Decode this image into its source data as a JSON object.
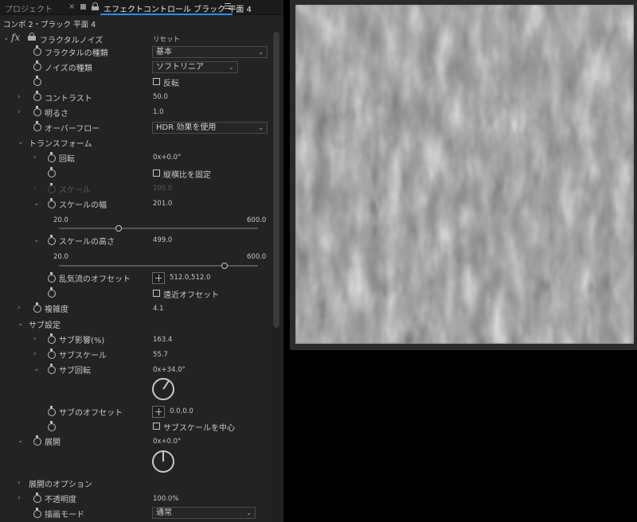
{
  "tabs": {
    "project": "プロジェクト",
    "close": "×",
    "effect_controls": "エフェクトコントロール ブラック 平面 4"
  },
  "comp_path": "コンポ 2・ブラック 平面 4",
  "effect": {
    "name": "フラクタルノイズ",
    "reset": "リセット"
  },
  "properties": {
    "fractal_type": {
      "label": "フラクタルの種類",
      "value": "基本"
    },
    "noise_type": {
      "label": "ノイズの種類",
      "value": "ソフトリニア"
    },
    "invert": {
      "label": "反転",
      "checked": false
    },
    "contrast": {
      "label": "コントラスト",
      "value": "50.0"
    },
    "brightness": {
      "label": "明るさ",
      "value": "1.0"
    },
    "overflow": {
      "label": "オーバーフロー",
      "value": "HDR 効果を使用"
    },
    "transform": {
      "label": "トランスフォーム",
      "rotation": {
        "label": "回転",
        "value": "0x+0.0°"
      },
      "uniform_scaling": {
        "label": "縦横比を固定",
        "checked": false
      },
      "scale": {
        "label": "スケール",
        "value": "100.0"
      },
      "scale_width": {
        "label": "スケールの幅",
        "value": "201.0",
        "min": "20.0",
        "max": "600.0",
        "fraction": 0.3
      },
      "scale_height": {
        "label": "スケールの高さ",
        "value": "499.0",
        "min": "20.0",
        "max": "600.0",
        "fraction": 0.83
      },
      "offset_turbulence": {
        "label": "乱気流のオフセット",
        "value": "512.0,512.0"
      },
      "perspective_offset": {
        "label": "遠近オフセット",
        "checked": false
      }
    },
    "complexity": {
      "label": "複雑度",
      "value": "4.1"
    },
    "sub_settings": {
      "label": "サブ設定",
      "sub_influence": {
        "label": "サブ影響(%)",
        "value": "163.4"
      },
      "sub_scaling": {
        "label": "サブスケール",
        "value": "55.7"
      },
      "sub_rotation": {
        "label": "サブ回転",
        "value": "0x+34.0°",
        "angle": 34
      },
      "sub_offset": {
        "label": "サブのオフセット",
        "value": "0.0,0.0"
      },
      "center_subscale": {
        "label": "サブスケールを中心",
        "checked": false
      }
    },
    "evolution": {
      "label": "展開",
      "value": "0x+0.0°",
      "angle": 0
    },
    "evolution_options": {
      "label": "展開のオプション"
    },
    "opacity": {
      "label": "不透明度",
      "value": "100.0%"
    },
    "blending_mode": {
      "label": "描画モード",
      "value": "通常"
    }
  },
  "colors": {
    "panel_bg": "#232323",
    "accent": "#2d8ceb",
    "preview_bg": "#8a8a8a"
  }
}
